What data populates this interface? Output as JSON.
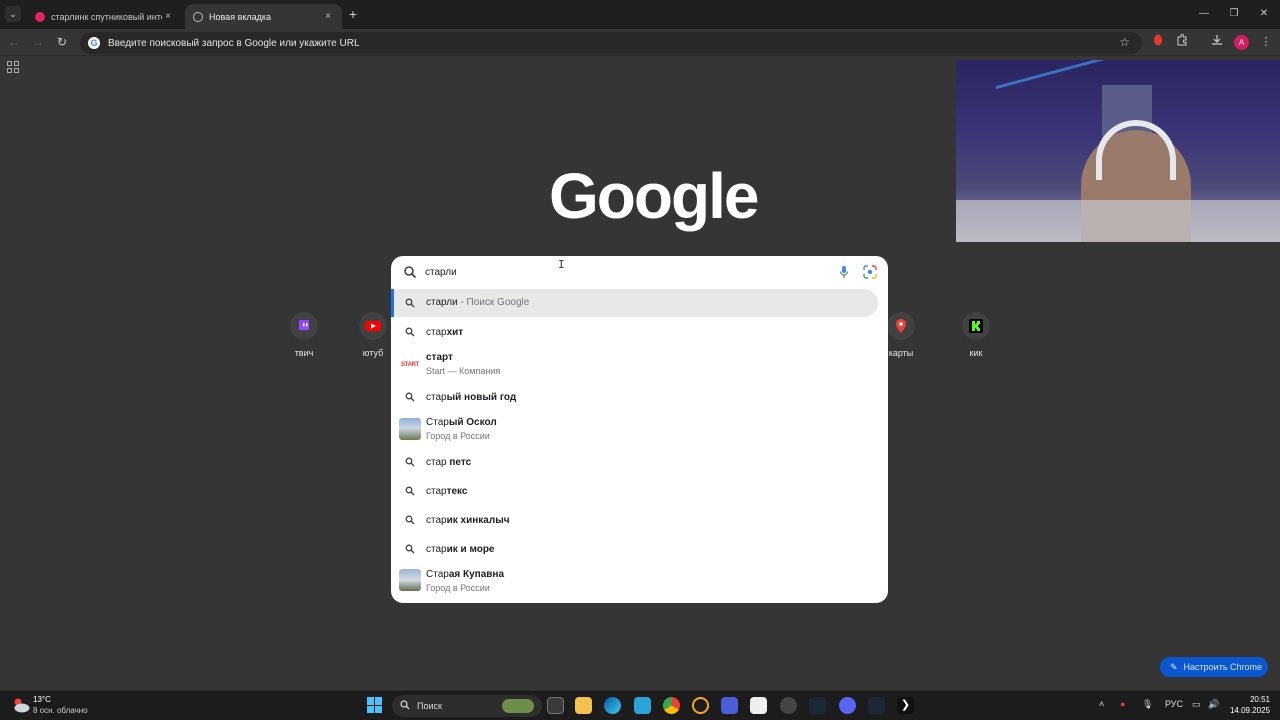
{
  "tabs": [
    {
      "title": "старлинк спутниковый интерн",
      "close": "×"
    },
    {
      "title": "Новая вкладка",
      "close": "×"
    }
  ],
  "new_tab_symbol": "+",
  "window_controls": {
    "minimize": "—",
    "maximize": "❐",
    "close": "✕"
  },
  "toolbar": {
    "back": "←",
    "forward": "→",
    "reload": "↻",
    "omnibox_placeholder": "Введите поисковый запрос в Google или укажите URL",
    "star": "☆",
    "avatar_letter": "A"
  },
  "logo": "Google",
  "shortcuts": [
    {
      "label": "твич",
      "color": "#9146ff"
    },
    {
      "label": "ютуб",
      "color": "#ff0000"
    },
    {
      "label": "карты",
      "color": "#ea4335"
    },
    {
      "label": "кик",
      "color": "#53fc18"
    }
  ],
  "search": {
    "value": "старли"
  },
  "suggestions": [
    {
      "prefix": "старли",
      "rest": " - Поиск Google",
      "type": "search"
    },
    {
      "prefix": "стар",
      "rest": "хит",
      "type": "search"
    },
    {
      "prefix": "старт",
      "rest": "",
      "sub": "Start — Компания",
      "type": "entity",
      "thumb_text": "START"
    },
    {
      "prefix": "стар",
      "rest": "ый новый год",
      "type": "search"
    },
    {
      "prefix": "Стар",
      "rest": "ый Оскол",
      "sub": "Город в России",
      "type": "entity"
    },
    {
      "prefix": "стар",
      "rest": " петс",
      "type": "search"
    },
    {
      "prefix": "стар",
      "rest": "текс",
      "type": "search"
    },
    {
      "prefix": "стар",
      "rest": "ик хинкалыч",
      "type": "search"
    },
    {
      "prefix": "стар",
      "rest": "ик и море",
      "type": "search"
    },
    {
      "prefix": "Стар",
      "rest": "ая Купавна",
      "sub": "Город в России",
      "type": "entity"
    }
  ],
  "customize_label": "Настроить Chrome",
  "taskbar": {
    "weather_temp": "13°C",
    "weather_desc": "8 осн. облачно",
    "search_label": "Поиск",
    "lang": "РУС",
    "time": "20:51",
    "date": "14.09.2025"
  },
  "colors": {
    "accent": "#1a73e8",
    "background": "#353535",
    "customize_bg": "#0b57d0"
  }
}
